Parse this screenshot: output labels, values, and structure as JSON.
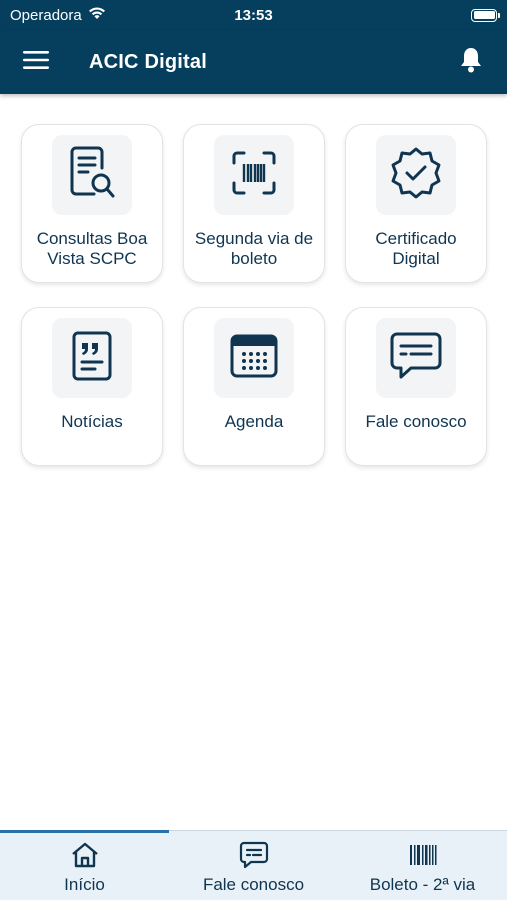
{
  "status_bar": {
    "carrier": "Operadora",
    "time": "13:53",
    "icons": [
      "wifi-icon",
      "battery-icon"
    ]
  },
  "app_bar": {
    "title": "ACIC Digital",
    "icons": [
      "menu-icon",
      "bell-icon"
    ]
  },
  "tiles": [
    {
      "label": "Consultas Boa Vista SCPC",
      "icon": "document-search-icon"
    },
    {
      "label": "Segunda via de boleto",
      "icon": "barcode-scan-icon"
    },
    {
      "label": "Certificado Digital",
      "icon": "certificate-badge-icon"
    },
    {
      "label": "Notícias",
      "icon": "news-quote-icon"
    },
    {
      "label": "Agenda",
      "icon": "calendar-icon"
    },
    {
      "label": "Fale conosco",
      "icon": "chat-bubble-icon"
    }
  ],
  "tab_bar": {
    "active": "Início",
    "tabs": [
      {
        "label": "Início",
        "icon": "home-icon"
      },
      {
        "label": "Fale conosco",
        "icon": "chat-bubble-icon"
      },
      {
        "label": "Boleto - 2ª via",
        "icon": "barcode-icon"
      }
    ]
  },
  "colors": {
    "primary": "#063f5e",
    "text": "#0f3550",
    "tile_icon_bg": "#f3f4f6",
    "tab_bar_bg": "#e9f1f8",
    "active_indicator": "#2a6fa8"
  }
}
